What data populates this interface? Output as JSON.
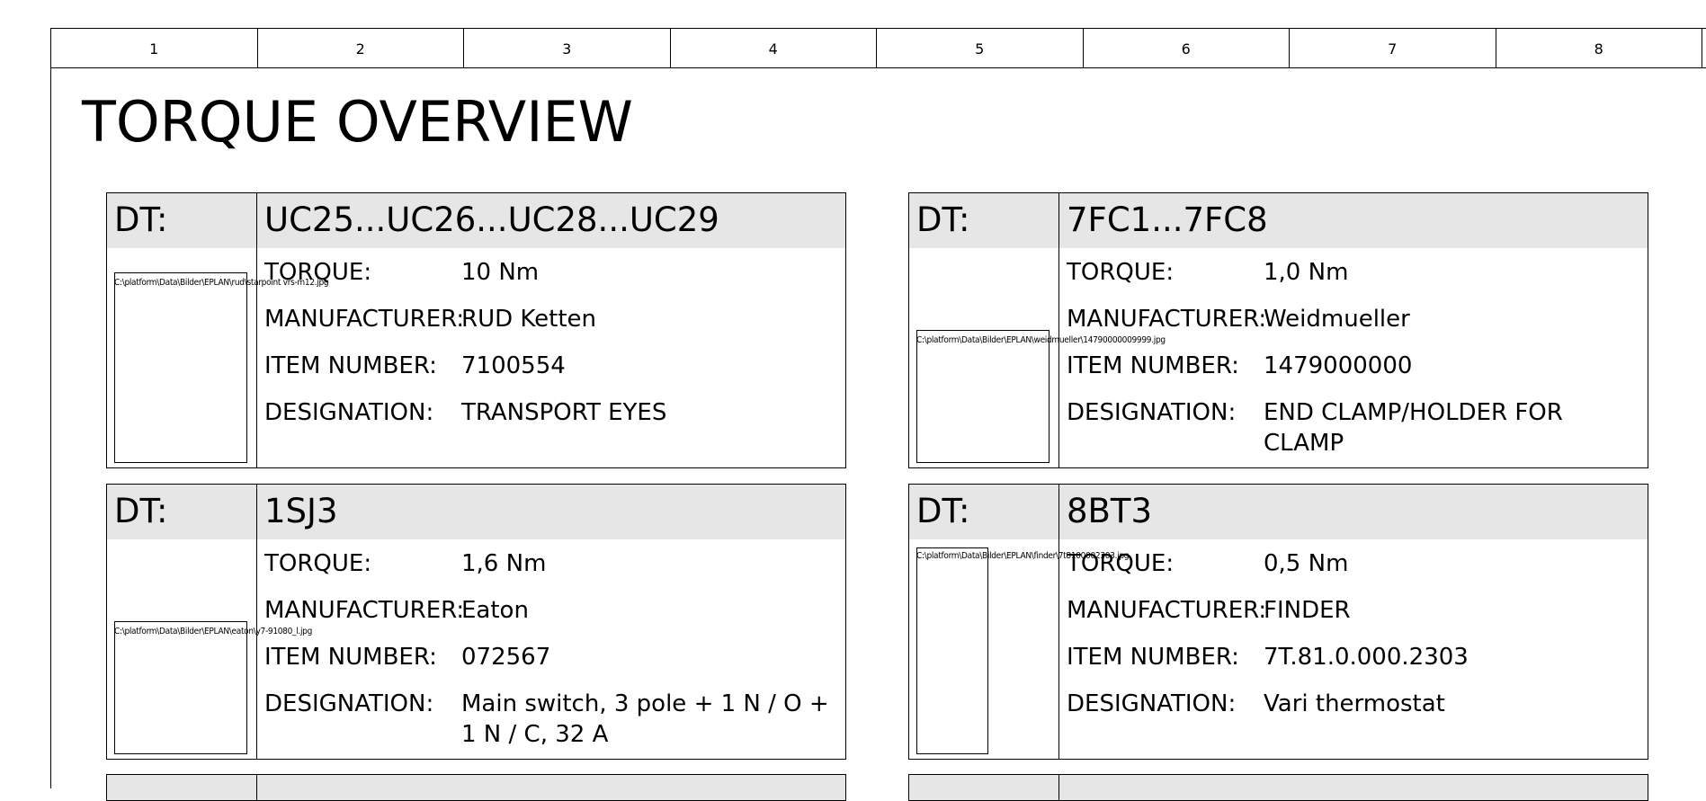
{
  "ruler": [
    "1",
    "2",
    "3",
    "4",
    "5",
    "6",
    "7",
    "8"
  ],
  "title": "TORQUE OVERVIEW",
  "labels": {
    "dt": "DT:",
    "torque": "TORQUE:",
    "manufacturer": "MANUFACTURER:",
    "item_number": "ITEM NUMBER:",
    "designation": "DESIGNATION:"
  },
  "cards": [
    {
      "dt": "UC25...UC26...UC28...UC29",
      "image_path": "C:\\platform\\Data\\Bilder\\EPLAN\\rud\\starpoint vrs-m12.jpg",
      "torque": "10 Nm",
      "manufacturer": "RUD Ketten",
      "item_number": "7100554",
      "designation": "TRANSPORT EYES"
    },
    {
      "dt": "7FC1...7FC8",
      "image_path": "C:\\platform\\Data\\Bilder\\EPLAN\\weidmueller\\14790000009999.jpg",
      "torque": "1,0 Nm",
      "manufacturer": "Weidmueller",
      "item_number": "1479000000",
      "designation": "END CLAMP/HOLDER FOR CLAMP"
    },
    {
      "dt": "1SJ3",
      "image_path": "C:\\platform\\Data\\Bilder\\EPLAN\\eaton\\y7-91080_l.jpg",
      "torque": "1,6 Nm",
      "manufacturer": "Eaton",
      "item_number": "072567",
      "designation": "Main switch, 3 pole + 1 N / O + 1 N / C, 32 A"
    },
    {
      "dt": "8BT3",
      "image_path": "C:\\platform\\Data\\Bilder\\EPLAN\\finder\\7t8100002303.jpg",
      "torque": "0,5 Nm",
      "manufacturer": "FINDER",
      "item_number": "7T.81.0.000.2303",
      "designation": "Vari thermostat"
    }
  ]
}
